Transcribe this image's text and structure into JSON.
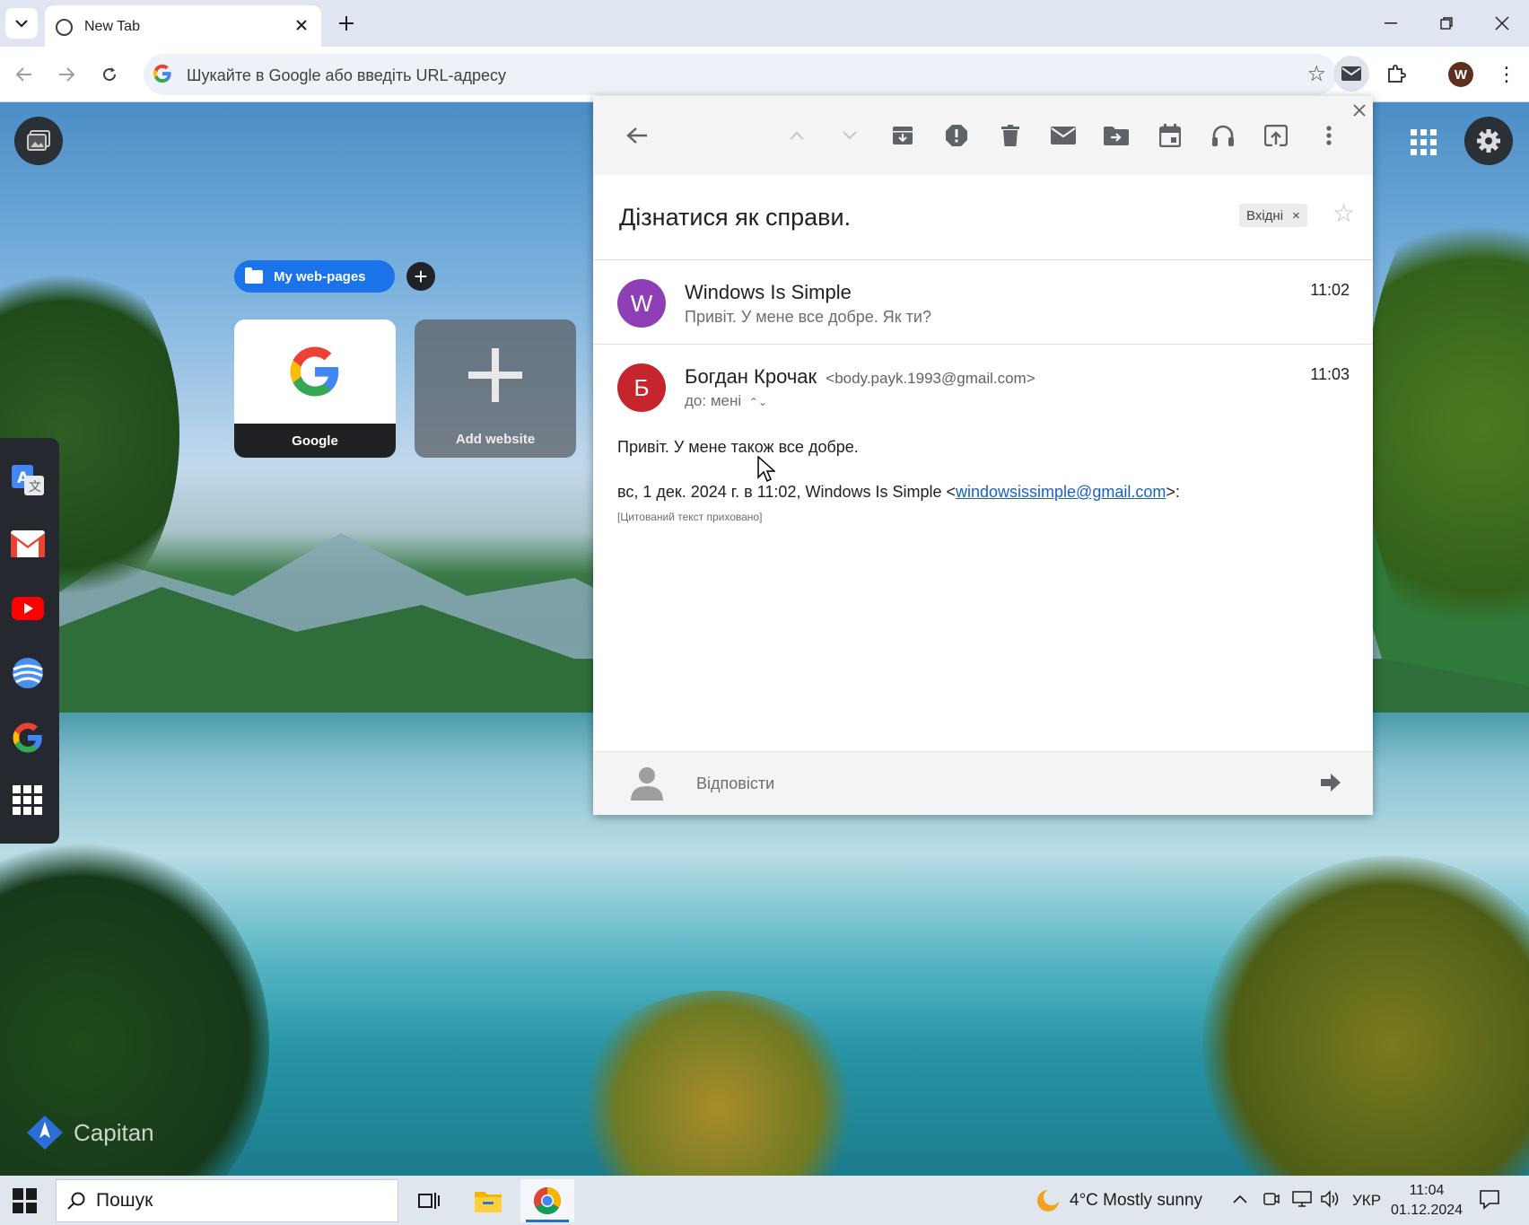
{
  "browser": {
    "tab_title": "New Tab",
    "omnibox_placeholder": "Шукайте в Google або введіть URL-адресу",
    "profile_initial": "W",
    "icons": [
      "tab-list-icon",
      "close-icon",
      "plus-icon",
      "minimize-icon",
      "restore-icon",
      "back-icon",
      "forward-icon",
      "reload-icon",
      "google-icon",
      "star-icon",
      "mail-icon",
      "extensions-icon",
      "more-icon"
    ]
  },
  "newtab": {
    "bookmark_folder": "My web-pages",
    "tiles": [
      {
        "label": "Google"
      },
      {
        "label": "Add website"
      }
    ],
    "dock": [
      "translate-icon",
      "gmail-icon",
      "youtube-icon",
      "earth-icon",
      "google-icon",
      "apps-icon"
    ],
    "brand": "Capitan"
  },
  "mail": {
    "subject": "Дізнатися як справи.",
    "label": "Вхідні",
    "messages": [
      {
        "avatar": "W",
        "avatar_color": "#8e3fb5",
        "sender": "Windows Is Simple",
        "snippet": "Привіт. У мене все добре. Як ти?",
        "time": "11:02"
      },
      {
        "avatar": "Б",
        "avatar_color": "#c5252c",
        "sender": "Богдан Крочак",
        "sender_email": "<body.payk.1993@gmail.com>",
        "to": "до: мені",
        "time": "11:03",
        "body": "Привіт. У мене також все добре.",
        "quote_prefix": "вс, 1 дек. 2024 г. в 11:02, Windows Is Simple <",
        "quote_link": "windowsissimple@gmail.com",
        "quote_suffix": ">:",
        "quoted_hidden": "[Цитований текст приховано]"
      }
    ],
    "reply_placeholder": "Відповісти"
  },
  "taskbar": {
    "search_placeholder": "Пошук",
    "weather": "4°C  Mostly sunny",
    "language": "УКР",
    "time": "11:04",
    "date": "01.12.2024"
  },
  "colors": {
    "accent": "#1a73e8",
    "link": "#1a5fc8"
  }
}
